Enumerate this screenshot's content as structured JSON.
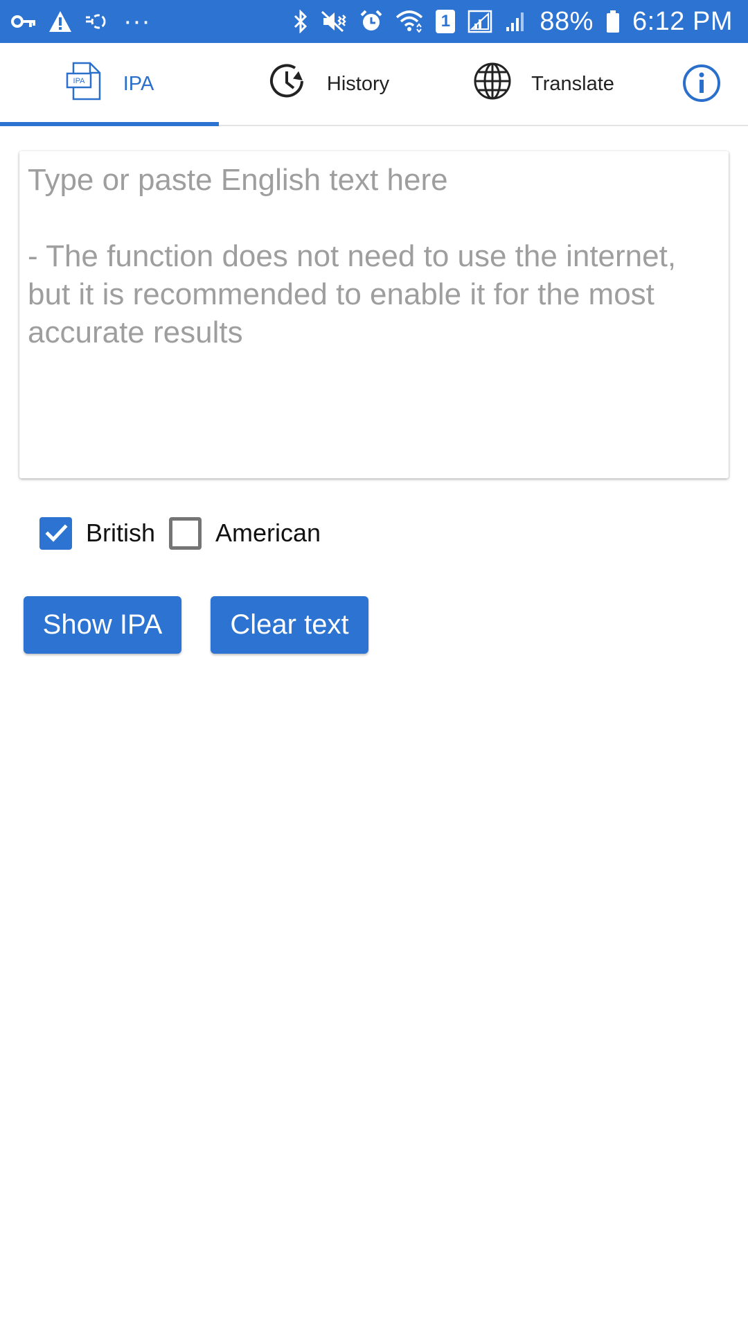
{
  "status_bar": {
    "left_icons": [
      "key-icon",
      "warning-icon",
      "sync-icon",
      "more-dots-icon"
    ],
    "more_dots": "···",
    "right_icons": [
      "bluetooth-icon",
      "vibrate-mute-icon",
      "alarm-icon",
      "wifi-icon",
      "sim-icon",
      "signal-icon",
      "signal-2-icon",
      "battery-icon"
    ],
    "sim_number": "1",
    "battery_percent": "88%",
    "time": "6:12 PM"
  },
  "tabs": [
    {
      "id": "ipa",
      "label": "IPA",
      "icon": "ipa-document-icon",
      "active": true
    },
    {
      "id": "history",
      "label": "History",
      "icon": "history-clock-icon",
      "active": false
    },
    {
      "id": "translate",
      "label": "Translate",
      "icon": "globe-icon",
      "active": false
    }
  ],
  "ipa_icon_text": "IPA",
  "info_icon": "info-icon",
  "text_input": {
    "value": "",
    "placeholder": "Type or paste English text here\n\n- The function does not need to use the internet, but it is recommended to enable it for the most accurate results"
  },
  "accent_options": [
    {
      "label": "British",
      "checked": true
    },
    {
      "label": "American",
      "checked": false
    }
  ],
  "buttons": {
    "show_ipa": "Show IPA",
    "clear_text": "Clear text"
  },
  "colors": {
    "accent": "#2c73d2",
    "status_bar": "#2c73d2",
    "placeholder": "#9e9e9e"
  }
}
